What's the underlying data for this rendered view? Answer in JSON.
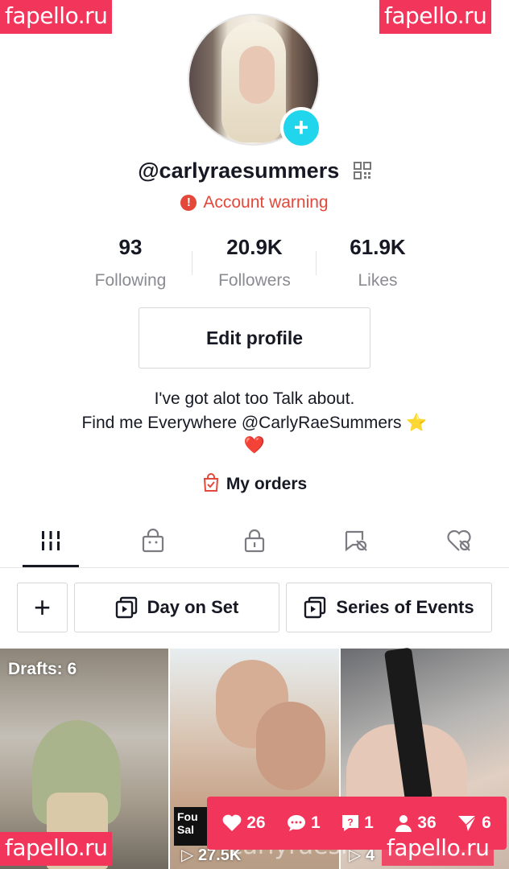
{
  "watermark": {
    "text": "fapello.ru",
    "overlay_text": "carlyraesı"
  },
  "profile": {
    "username": "@carlyraesummers",
    "warning": "Account warning",
    "stats": [
      {
        "value": "93",
        "label": "Following"
      },
      {
        "value": "20.9K",
        "label": "Followers"
      },
      {
        "value": "61.9K",
        "label": "Likes"
      }
    ],
    "edit_label": "Edit profile",
    "bio_line1": "I've got alot too Talk about.",
    "bio_line2": "Find me Everywhere @CarlyRaeSummers ⭐",
    "bio_line3": "❤️",
    "orders_label": "My orders"
  },
  "tabs": [
    "grid-icon",
    "shop-bag-icon",
    "lock-icon",
    "tagged-icon",
    "liked-icon"
  ],
  "playlists": {
    "add_label": "+",
    "items": [
      {
        "label": "Day on Set"
      },
      {
        "label": "Series of Events"
      }
    ]
  },
  "videos": {
    "drafts": "Drafts: 6",
    "thumb2_label": "Fou\nSal",
    "views": [
      "27.5K",
      "4"
    ]
  },
  "counter_bar": {
    "likes": "26",
    "comments": "1",
    "questions": "1",
    "followers": "36",
    "shares": "6"
  },
  "colors": {
    "accent": "#f2355b",
    "plus": "#20d5ec",
    "warning": "#e4483a",
    "muted": "#8a8b91"
  }
}
